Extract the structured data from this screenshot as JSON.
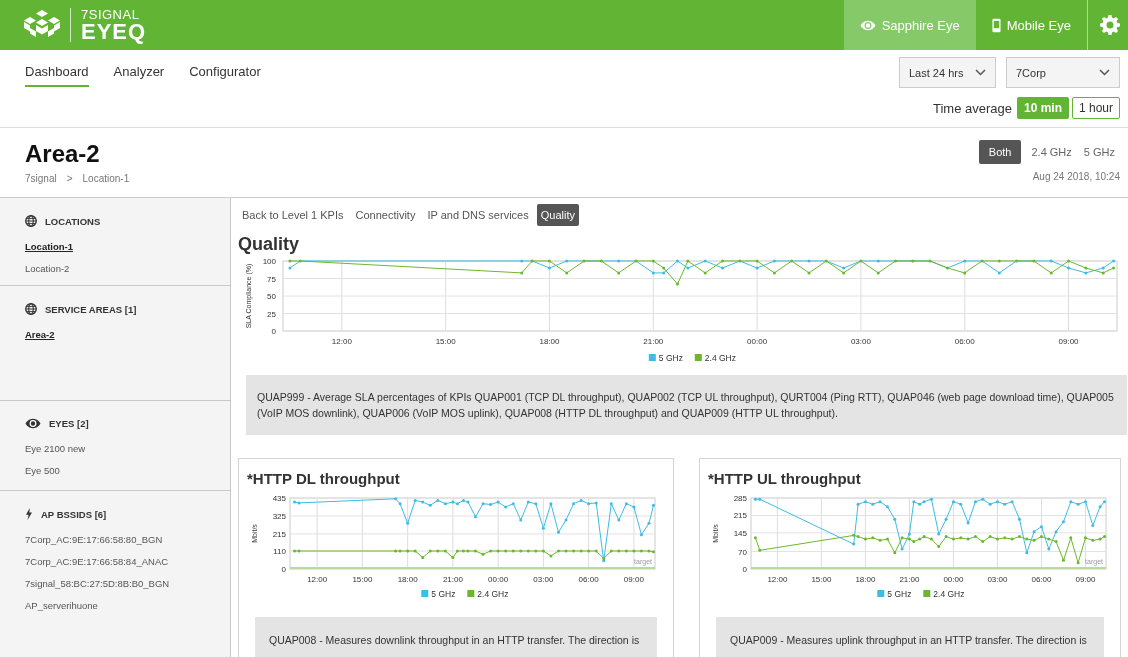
{
  "header": {
    "logo": {
      "top": "7SIGNAL",
      "bottom": "EYEQ"
    },
    "products": [
      {
        "label": "Sapphire Eye",
        "selected": true
      },
      {
        "label": "Mobile Eye",
        "selected": false
      }
    ]
  },
  "nav": {
    "tabs": [
      {
        "label": "Dashboard",
        "selected": true
      },
      {
        "label": "Analyzer",
        "selected": false
      },
      {
        "label": "Configurator",
        "selected": false
      }
    ],
    "dropdowns": [
      {
        "value": "Last 24 hrs"
      },
      {
        "value": "7Corp"
      }
    ],
    "time_average": {
      "label": "Time average",
      "options": [
        {
          "label": "10 min",
          "selected": true
        },
        {
          "label": "1 hour",
          "selected": false
        }
      ]
    }
  },
  "area": {
    "title": "Area-2",
    "breadcrumb": [
      "7signal",
      ">",
      "Location-1"
    ],
    "bands": [
      {
        "label": "Both",
        "selected": true
      },
      {
        "label": "2.4 GHz",
        "selected": false
      },
      {
        "label": "5 GHz",
        "selected": false
      }
    ],
    "timestamp": "Aug 24 2018, 10:24"
  },
  "sidebar": {
    "sections": [
      {
        "title": "LOCATIONS",
        "items": [
          {
            "label": "Location-1",
            "selected": true
          },
          {
            "label": "Location-2",
            "selected": false
          }
        ]
      },
      {
        "title": "SERVICE AREAS [1]",
        "items": [
          {
            "label": "Area-2",
            "selected": true
          }
        ]
      },
      {
        "title": "EYES [2]",
        "items": [
          {
            "label": "Eye 2100 new",
            "selected": false
          },
          {
            "label": "Eye 500",
            "selected": false
          }
        ]
      },
      {
        "title": "AP BSSIDS [6]",
        "items": [
          {
            "label": "7Corp_AC:9E:17:66:58:80_BGN",
            "selected": false
          },
          {
            "label": "7Corp_AC:9E:17:66:58:84_ANAC",
            "selected": false
          },
          {
            "label": "7signal_58:BC:27:5D:8B:B0_BGN",
            "selected": false
          },
          {
            "label": "AP_serverihuone",
            "selected": false
          }
        ]
      }
    ]
  },
  "kpi_tabs": [
    {
      "label": "Back to Level 1 KPIs",
      "selected": false
    },
    {
      "label": "Connectivity",
      "selected": false
    },
    {
      "label": "IP and DNS services",
      "selected": false
    },
    {
      "label": "Quality",
      "selected": true
    }
  ],
  "quality": {
    "title": "Quality",
    "chart_data": {
      "type": "line",
      "ylabel": "SLA Compliance (%)",
      "x": [
        "2018-08-23T10:30",
        "2018-08-23T10:48",
        "2018-08-23T17:12",
        "2018-08-23T17:30",
        "2018-08-23T18:00",
        "2018-08-23T18:30",
        "2018-08-23T19:00",
        "2018-08-23T19:30",
        "2018-08-23T20:00",
        "2018-08-23T20:30",
        "2018-08-23T21:00",
        "2018-08-23T21:18",
        "2018-08-23T21:42",
        "2018-08-23T22:00",
        "2018-08-23T22:30",
        "2018-08-23T23:00",
        "2018-08-23T23:30",
        "2018-08-24T00:00",
        "2018-08-24T00:30",
        "2018-08-24T01:00",
        "2018-08-24T01:30",
        "2018-08-24T02:00",
        "2018-08-24T02:30",
        "2018-08-24T03:00",
        "2018-08-24T03:30",
        "2018-08-24T04:00",
        "2018-08-24T04:30",
        "2018-08-24T05:00",
        "2018-08-24T05:30",
        "2018-08-24T06:00",
        "2018-08-24T06:30",
        "2018-08-24T07:00",
        "2018-08-24T07:30",
        "2018-08-24T08:00",
        "2018-08-24T08:30",
        "2018-08-24T09:00",
        "2018-08-24T09:30",
        "2018-08-24T10:00",
        "2018-08-24T10:18"
      ],
      "series": [
        {
          "name": "5 GHz",
          "color": "#3cbde6",
          "values": [
            90,
            100,
            100,
            100,
            90,
            100,
            100,
            100,
            100,
            100,
            83,
            83,
            100,
            90,
            100,
            90,
            100,
            90,
            100,
            100,
            100,
            100,
            90,
            100,
            100,
            100,
            100,
            100,
            90,
            100,
            100,
            83,
            100,
            100,
            100,
            90,
            83,
            90,
            100
          ]
        },
        {
          "name": "2.4 GHz",
          "color": "#6bb82c",
          "values": [
            100,
            100,
            83,
            100,
            100,
            83,
            100,
            100,
            83,
            100,
            100,
            90,
            67,
            100,
            83,
            100,
            100,
            100,
            83,
            100,
            83,
            100,
            83,
            100,
            83,
            100,
            100,
            100,
            90,
            83,
            100,
            100,
            100,
            100,
            83,
            100,
            90,
            83,
            90
          ]
        }
      ],
      "xlim": [
        "2018-08-23T10:18",
        "2018-08-24T10:24"
      ],
      "ylim": [
        0,
        100
      ],
      "xticks": [
        {
          "value": "2018-08-23T12:00",
          "label": "12:00"
        },
        {
          "value": "2018-08-23T15:00",
          "label": "15:00"
        },
        {
          "value": "2018-08-23T18:00",
          "label": "18:00"
        },
        {
          "value": "2018-08-23T21:00",
          "label": "21:00"
        },
        {
          "value": "2018-08-24T00:00",
          "label": "00:00"
        },
        {
          "value": "2018-08-24T03:00",
          "label": "03:00"
        },
        {
          "value": "2018-08-24T06:00",
          "label": "06:00"
        },
        {
          "value": "2018-08-24T09:00",
          "label": "09:00"
        }
      ],
      "yticks": [
        0,
        25,
        50,
        75,
        100
      ],
      "grid": true,
      "legend": "bottom"
    },
    "description": "QUAP999 - Average SLA percentages of KPIs QUAP001 (TCP DL throughput), QUAP002 (TCP UL throughput), QURT004 (Ping RTT), QUAP046 (web page download time), QUAP005 (VoIP MOS downlink), QUAP006 (VoIP MOS uplink), QUAP008 (HTTP DL throughput) and QUAP009 (HTTP UL throughput)."
  },
  "cards": [
    {
      "title": "*HTTP DL throughput",
      "chart_data": {
        "type": "line",
        "ylabel": "Mbit/s",
        "x": [
          "2018-08-23T10:30",
          "2018-08-23T10:48",
          "2018-08-23T17:12",
          "2018-08-23T17:30",
          "2018-08-23T18:00",
          "2018-08-23T18:30",
          "2018-08-23T19:00",
          "2018-08-23T19:30",
          "2018-08-23T20:00",
          "2018-08-23T20:30",
          "2018-08-23T21:00",
          "2018-08-23T21:18",
          "2018-08-23T21:42",
          "2018-08-23T22:00",
          "2018-08-23T22:30",
          "2018-08-23T23:00",
          "2018-08-23T23:30",
          "2018-08-24T00:00",
          "2018-08-24T00:30",
          "2018-08-24T01:00",
          "2018-08-24T01:30",
          "2018-08-24T02:00",
          "2018-08-24T02:30",
          "2018-08-24T03:00",
          "2018-08-24T03:30",
          "2018-08-24T04:00",
          "2018-08-24T04:30",
          "2018-08-24T05:00",
          "2018-08-24T05:30",
          "2018-08-24T06:00",
          "2018-08-24T06:30",
          "2018-08-24T07:00",
          "2018-08-24T07:30",
          "2018-08-24T08:00",
          "2018-08-24T08:30",
          "2018-08-24T09:00",
          "2018-08-24T09:30",
          "2018-08-24T10:00",
          "2018-08-24T10:18"
        ],
        "series": [
          {
            "name": "5 GHz",
            "color": "#3cbde6",
            "values": [
              410,
              405,
              430,
              400,
              280,
              420,
              410,
              390,
              420,
              400,
              410,
              400,
              420,
              410,
              320,
              400,
              395,
              410,
              380,
              400,
              300,
              410,
              400,
              250,
              400,
              225,
              300,
              400,
              420,
              400,
              405,
              50,
              400,
              300,
              400,
              380,
              210,
              280,
              390
            ]
          },
          {
            "name": "2.4 GHz",
            "color": "#6bb82c",
            "values": [
              110,
              110,
              110,
              110,
              110,
              110,
              70,
              110,
              110,
              110,
              70,
              110,
              110,
              110,
              110,
              90,
              110,
              110,
              110,
              110,
              110,
              110,
              110,
              110,
              80,
              110,
              110,
              110,
              110,
              110,
              110,
              65,
              110,
              110,
              110,
              110,
              110,
              110,
              105
            ]
          }
        ],
        "xlim": [
          "2018-08-23T10:12",
          "2018-08-24T10:24"
        ],
        "ylim": [
          0,
          435
        ],
        "xticks": [
          {
            "value": "2018-08-23T12:00",
            "label": "12:00"
          },
          {
            "value": "2018-08-23T15:00",
            "label": "15:00"
          },
          {
            "value": "2018-08-23T18:00",
            "label": "18:00"
          },
          {
            "value": "2018-08-23T21:00",
            "label": "21:00"
          },
          {
            "value": "2018-08-24T00:00",
            "label": "00:00"
          },
          {
            "value": "2018-08-24T03:00",
            "label": "03:00"
          },
          {
            "value": "2018-08-24T06:00",
            "label": "06:00"
          },
          {
            "value": "2018-08-24T09:00",
            "label": "09:00"
          }
        ],
        "yticks": [
          0,
          110,
          215,
          325,
          435
        ],
        "grid": true,
        "legend": "bottom",
        "annotations": [
          "target"
        ]
      },
      "description": "QUAP008 - Measures downlink throughput in an HTTP transfer. The direction is"
    },
    {
      "title": "*HTTP UL throughput",
      "chart_data": {
        "type": "line",
        "ylabel": "Mbit/s",
        "x": [
          "2018-08-23T10:30",
          "2018-08-23T10:48",
          "2018-08-23T17:12",
          "2018-08-23T17:30",
          "2018-08-23T18:00",
          "2018-08-23T18:30",
          "2018-08-23T19:00",
          "2018-08-23T19:30",
          "2018-08-23T20:00",
          "2018-08-23T20:30",
          "2018-08-23T21:00",
          "2018-08-23T21:18",
          "2018-08-23T21:42",
          "2018-08-23T22:00",
          "2018-08-23T22:30",
          "2018-08-23T23:00",
          "2018-08-23T23:30",
          "2018-08-24T00:00",
          "2018-08-24T00:30",
          "2018-08-24T01:00",
          "2018-08-24T01:30",
          "2018-08-24T02:00",
          "2018-08-24T02:30",
          "2018-08-24T03:00",
          "2018-08-24T03:30",
          "2018-08-24T04:00",
          "2018-08-24T04:30",
          "2018-08-24T05:00",
          "2018-08-24T05:30",
          "2018-08-24T06:00",
          "2018-08-24T06:30",
          "2018-08-24T07:00",
          "2018-08-24T07:30",
          "2018-08-24T08:00",
          "2018-08-24T08:30",
          "2018-08-24T09:00",
          "2018-08-24T09:30",
          "2018-08-24T10:00",
          "2018-08-24T10:18"
        ],
        "series": [
          {
            "name": "5 GHz",
            "color": "#3cbde6",
            "values": [
              280,
              280,
              100,
              260,
              270,
              260,
              270,
              250,
              200,
              80,
              140,
              270,
              260,
              270,
              280,
              140,
              200,
              270,
              260,
              185,
              270,
              280,
              260,
              270,
              260,
              270,
              200,
              65,
              150,
              170,
              80,
              150,
              190,
              270,
              260,
              270,
              175,
              250,
              270
            ]
          },
          {
            "name": "2.4 GHz",
            "color": "#6bb82c",
            "values": [
              125,
              75,
              135,
              130,
              120,
              125,
              115,
              120,
              65,
              125,
              120,
              110,
              120,
              130,
              120,
              90,
              130,
              120,
              125,
              120,
              130,
              110,
              130,
              120,
              125,
              120,
              130,
              120,
              115,
              130,
              120,
              110,
              35,
              125,
              25,
              125,
              115,
              120,
              130
            ]
          }
        ],
        "xlim": [
          "2018-08-23T10:12",
          "2018-08-24T10:24"
        ],
        "ylim": [
          0,
          285
        ],
        "xticks": [
          {
            "value": "2018-08-23T12:00",
            "label": "12:00"
          },
          {
            "value": "2018-08-23T15:00",
            "label": "15:00"
          },
          {
            "value": "2018-08-23T18:00",
            "label": "18:00"
          },
          {
            "value": "2018-08-23T21:00",
            "label": "21:00"
          },
          {
            "value": "2018-08-24T00:00",
            "label": "00:00"
          },
          {
            "value": "2018-08-24T03:00",
            "label": "03:00"
          },
          {
            "value": "2018-08-24T06:00",
            "label": "06:00"
          },
          {
            "value": "2018-08-24T09:00",
            "label": "09:00"
          }
        ],
        "yticks": [
          0,
          70,
          145,
          215,
          285
        ],
        "grid": true,
        "legend": "bottom",
        "annotations": [
          "target"
        ]
      },
      "description": "QUAP009 - Measures uplink throughput in an HTTP transfer. The direction is"
    }
  ]
}
